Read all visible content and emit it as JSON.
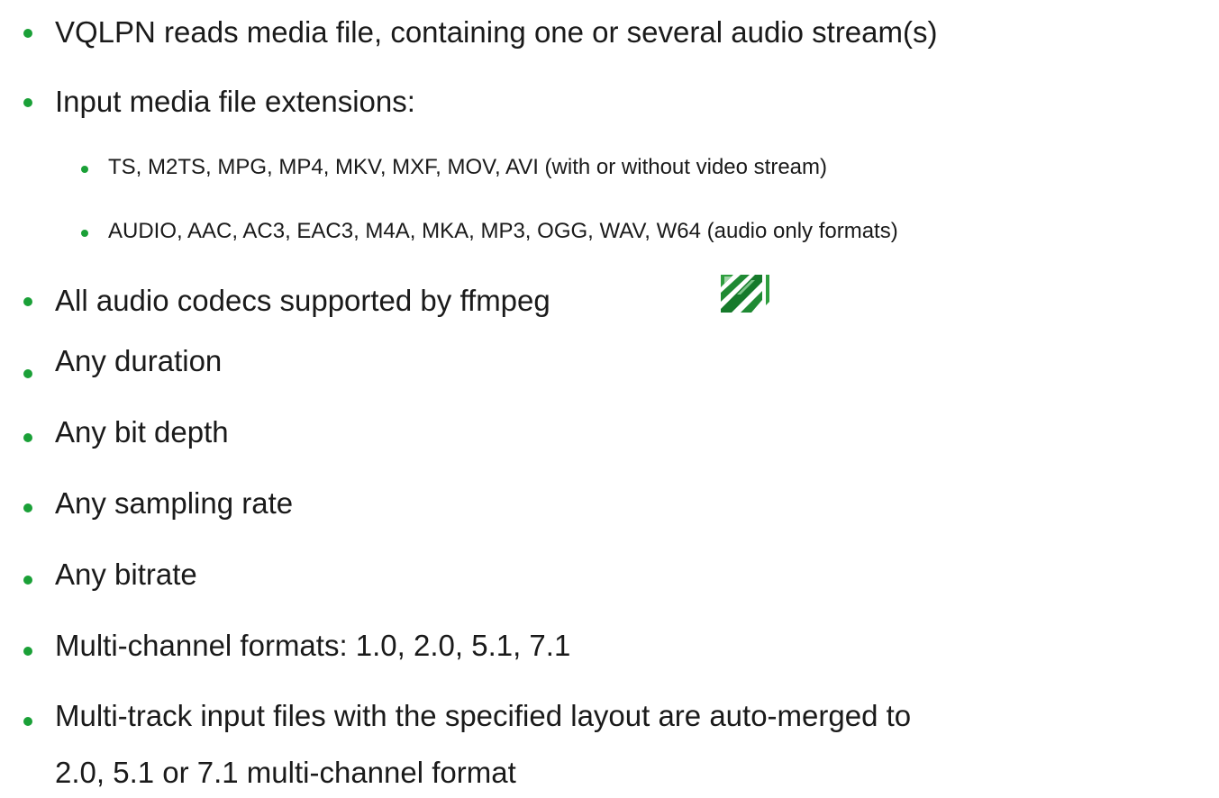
{
  "bullets": [
    {
      "text": "VQLPN reads media file, containing one or several audio stream(s)",
      "level": 1
    },
    {
      "text": "Input media file extensions:",
      "level": 1
    },
    {
      "text": "TS, M2TS, MPG, MP4, MKV, MXF, MOV, AVI (with or without video stream)",
      "level": 2
    },
    {
      "text": "AUDIO, AAC, AC3, EAC3, M4A, MKA, MP3, OGG, WAV, W64 (audio only formats)",
      "level": 2
    },
    {
      "text": "All audio codecs supported by ffmpeg",
      "level": 1,
      "icon": "ffmpeg-logo-icon"
    },
    {
      "text": "Any duration",
      "level": 1
    },
    {
      "text": "Any bit depth",
      "level": 1
    },
    {
      "text": "Any sampling rate",
      "level": 1
    },
    {
      "text": "Any bitrate",
      "level": 1
    },
    {
      "text": "Multi-channel formats: 1.0, 2.0, 5.1, 7.1",
      "level": 1
    },
    {
      "text": "Multi-track input files with the specified layout are auto-merged to",
      "level": 1
    },
    {
      "text": "2.0, 5.1 or 7.1 multi-channel format",
      "level": 1,
      "continuation": true
    }
  ],
  "colors": {
    "bullet": "#1aa037",
    "text": "#1a1a1a",
    "logo_green": "#1c8c2e"
  }
}
